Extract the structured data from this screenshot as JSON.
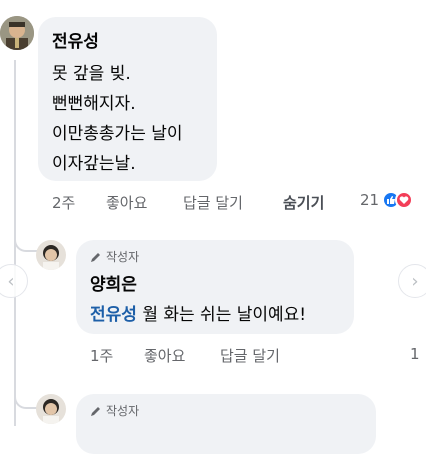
{
  "comments": [
    {
      "author": "전유성",
      "lines": [
        "못 갚을 빚.",
        "뻔뻔해지자.",
        "이만총총가는 날이",
        "이자갚는날."
      ],
      "time": "2주",
      "actions": {
        "like": "좋아요",
        "reply": "답글 달기",
        "hide": "숨기기"
      },
      "reaction_count": "21"
    },
    {
      "badge": "작성자",
      "author": "양희은",
      "mention": "전유성",
      "text": " 월 화는 쉬는 날이예요!",
      "time": "1주",
      "actions": {
        "like": "좋아요",
        "reply": "답글 달기"
      },
      "reaction_count": "1"
    },
    {
      "badge": "작성자"
    }
  ],
  "colors": {
    "bubble": "#f0f2f5",
    "mention": "#1d5fa8",
    "meta": "#65676b",
    "like": "#1877f2",
    "love": "#f33e58"
  }
}
